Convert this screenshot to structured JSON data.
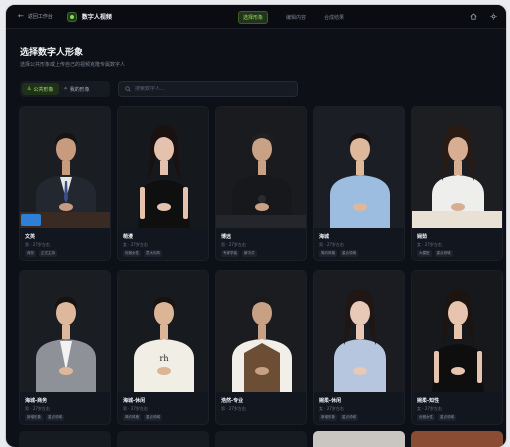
{
  "topbar": {
    "back_label": "返回工作台",
    "app_title": "数字人视频",
    "steps": [
      "选择形象",
      "编辑内容",
      "合成结果"
    ]
  },
  "page": {
    "title": "选择数字人形象",
    "subtitle": "选择公共形象或上传自己的视频克隆专属数字人"
  },
  "tabs": [
    {
      "label": "公共形象",
      "icon": "person-icon",
      "active": true
    },
    {
      "label": "我的形象",
      "icon": "sparkle-icon",
      "active": false
    }
  ],
  "search": {
    "placeholder": "搜索数字人..."
  },
  "avatars": [
    {
      "name": "文英",
      "meta": "男 · 27岁左右",
      "tags": [
        "商务",
        "正式主持"
      ],
      "bg": "#1a1d22",
      "skin": "#c89a7e",
      "hair": "#141414",
      "top": "#23272f",
      "style": "suit",
      "gender": "m"
    },
    {
      "name": "萌漫",
      "meta": "女 · 27岁左右",
      "tags": [
        "优雅女性",
        "意大利风"
      ],
      "bg": "#15181d",
      "skin": "#e4c2ad",
      "hair": "#1a1210",
      "top": "#0f0f10",
      "style": "dress",
      "gender": "f"
    },
    {
      "name": "博远",
      "meta": "男 · 27岁左右",
      "tags": [
        "专家学者",
        "新中式"
      ],
      "bg": "#1a1b1f",
      "skin": "#c9a184",
      "hair": "#202020",
      "top": "#17181b",
      "style": "tang",
      "gender": "m"
    },
    {
      "name": "海城",
      "meta": "男 · 27岁左右",
      "tags": [
        "简约风格",
        "重点领域"
      ],
      "bg": "#1b1e24",
      "skin": "#ddb89b",
      "hair": "#17120f",
      "top": "#9dbde0",
      "style": "shirt",
      "gender": "m"
    },
    {
      "name": "娴茹",
      "meta": "女 · 27岁左右",
      "tags": [
        "大模型",
        "重点领域"
      ],
      "bg": "#1c1e22",
      "skin": "#d8ae92",
      "hair": "#2a1a14",
      "top": "#eeeeec",
      "style": "blouse",
      "gender": "f"
    },
    {
      "name": "海城-商务",
      "meta": "男 · 27岁左右",
      "tags": [
        "新增形象",
        "重点领域"
      ],
      "bg": "#1a1d22",
      "skin": "#ddb89b",
      "hair": "#17120f",
      "top": "#8e9298",
      "style": "blazer",
      "gender": "m"
    },
    {
      "name": "海城-休闲",
      "meta": "男 · 27岁左右",
      "tags": [
        "简约风格",
        "重点领域"
      ],
      "bg": "#171a1f",
      "skin": "#dcb597",
      "hair": "#17120f",
      "top": "#f1eee6",
      "style": "tee",
      "gender": "m",
      "tee_text": "rh"
    },
    {
      "name": "浩然-专业",
      "meta": "男 · 27岁左右",
      "tags": [],
      "bg": "#1b1c1f",
      "skin": "#c8a084",
      "hair": "#1a1a1a",
      "top": "#6b4e34",
      "style": "vest",
      "gender": "m"
    },
    {
      "name": "婉柔-休闲",
      "meta": "女 · 27岁左右",
      "tags": [
        "新增形象",
        "重点领域"
      ],
      "bg": "#1a1c22",
      "skin": "#e8c8b6",
      "hair": "#201613",
      "top": "#b6c6de",
      "style": "blouse",
      "gender": "f"
    },
    {
      "name": "婉柔-知性",
      "meta": "女 · 27岁左右",
      "tags": [
        "优雅女性",
        "重点领域"
      ],
      "bg": "#16181c",
      "skin": "#e6c4ae",
      "hair": "#1c1411",
      "top": "#0e0e0f",
      "style": "dress",
      "gender": "f"
    }
  ],
  "next_row_bgs": [
    "#161a21",
    "#161a21",
    "#161a21",
    "#c9c6c2",
    "#8b4c34"
  ],
  "colors": {
    "accent": "#9fe05c",
    "badge": "#2e7fd6"
  }
}
